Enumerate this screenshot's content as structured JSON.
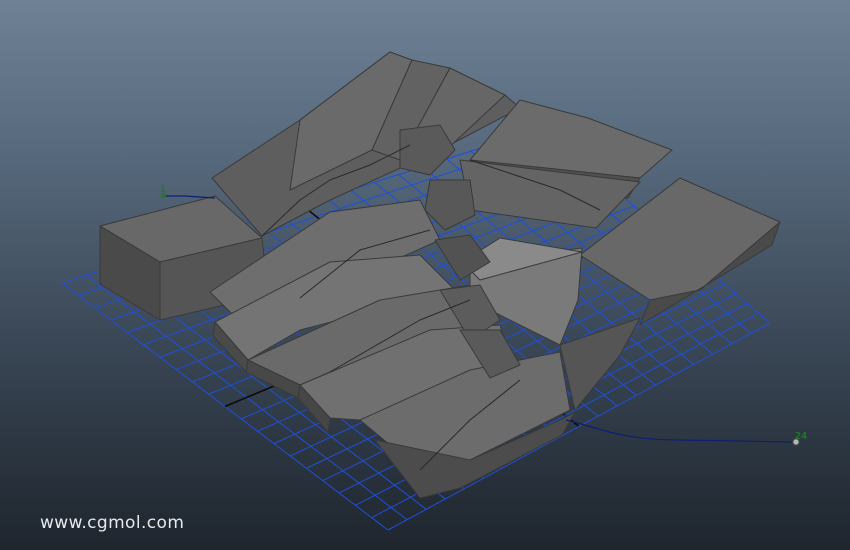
{
  "viewport": {
    "background_top": "#6f8295",
    "background_bottom": "#1e252d",
    "grid_color": "#1f4fd8",
    "mesh_color": "#5c5c5c",
    "curve_color": "#0f1f6e",
    "objects": [
      "ground-grid",
      "shattered-slab-mesh",
      "motion-path-curve"
    ]
  },
  "motion_path": {
    "start_frame": "1",
    "end_frame": "24"
  },
  "watermark": "www.cgmol.com"
}
